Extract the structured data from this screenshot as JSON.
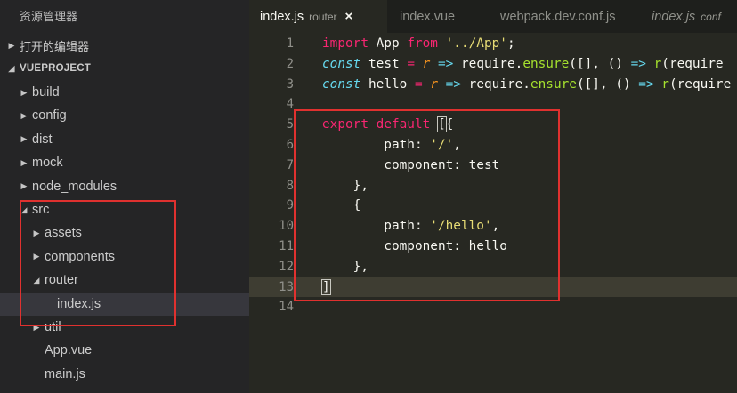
{
  "explorer": {
    "title": "资源管理器",
    "open_editors": "打开的编辑器",
    "project": "VUEPROJECT"
  },
  "tree": [
    {
      "label": "build",
      "kind": "folder",
      "expanded": false,
      "depth": 0
    },
    {
      "label": "config",
      "kind": "folder",
      "expanded": false,
      "depth": 0
    },
    {
      "label": "dist",
      "kind": "folder",
      "expanded": false,
      "depth": 0
    },
    {
      "label": "mock",
      "kind": "folder",
      "expanded": false,
      "depth": 0
    },
    {
      "label": "node_modules",
      "kind": "folder",
      "expanded": false,
      "depth": 0
    },
    {
      "label": "src",
      "kind": "folder",
      "expanded": true,
      "depth": 0
    },
    {
      "label": "assets",
      "kind": "folder",
      "expanded": false,
      "depth": 1
    },
    {
      "label": "components",
      "kind": "folder",
      "expanded": false,
      "depth": 1
    },
    {
      "label": "router",
      "kind": "folder",
      "expanded": true,
      "depth": 1
    },
    {
      "label": "index.js",
      "kind": "file",
      "depth": 2,
      "selected": true
    },
    {
      "label": "util",
      "kind": "folder",
      "expanded": false,
      "depth": 1
    },
    {
      "label": "App.vue",
      "kind": "file",
      "depth": 1
    },
    {
      "label": "main.js",
      "kind": "file",
      "depth": 1
    }
  ],
  "tabs": [
    {
      "label": "index.js",
      "description": "router",
      "active": true,
      "close": "×"
    },
    {
      "label": "index.vue",
      "description": "",
      "active": false
    },
    {
      "label": "webpack.dev.conf.js",
      "description": "",
      "active": false
    },
    {
      "label": "index.js",
      "description": "conf",
      "active": false,
      "italic": true
    }
  ],
  "code_lines": [
    {
      "n": "1",
      "tokens": [
        [
          "kw",
          "import"
        ],
        [
          "pl",
          " App "
        ],
        [
          "kw",
          "from"
        ],
        [
          "pl",
          " "
        ],
        [
          "str",
          "'../App'"
        ],
        [
          "pl",
          ";"
        ]
      ]
    },
    {
      "n": "2",
      "tokens": [
        [
          "st",
          "const"
        ],
        [
          "pl",
          " test "
        ],
        [
          "kw",
          "="
        ],
        [
          "pl",
          " "
        ],
        [
          "par",
          "r"
        ],
        [
          "pl",
          " "
        ],
        [
          "st",
          "=>"
        ],
        [
          "pl",
          " require."
        ],
        [
          "fn",
          "ensure"
        ],
        [
          "pl",
          "([], () "
        ],
        [
          "st",
          "=>"
        ],
        [
          "pl",
          " "
        ],
        [
          "fn",
          "r"
        ],
        [
          "pl",
          "(require"
        ]
      ]
    },
    {
      "n": "3",
      "tokens": [
        [
          "st",
          "const"
        ],
        [
          "pl",
          " hello "
        ],
        [
          "kw",
          "="
        ],
        [
          "pl",
          " "
        ],
        [
          "par",
          "r"
        ],
        [
          "pl",
          " "
        ],
        [
          "st",
          "=>"
        ],
        [
          "pl",
          " require."
        ],
        [
          "fn",
          "ensure"
        ],
        [
          "pl",
          "([], () "
        ],
        [
          "st",
          "=>"
        ],
        [
          "pl",
          " "
        ],
        [
          "fn",
          "r"
        ],
        [
          "pl",
          "(require"
        ]
      ]
    },
    {
      "n": "4",
      "tokens": []
    },
    {
      "n": "5",
      "tokens": [
        [
          "kw",
          "export"
        ],
        [
          "pl",
          " "
        ],
        [
          "kw",
          "default"
        ],
        [
          "pl",
          " "
        ],
        [
          "bracket",
          "["
        ],
        [
          "pl",
          "{"
        ]
      ]
    },
    {
      "n": "6",
      "tokens": [
        [
          "pl",
          "        path: "
        ],
        [
          "str",
          "'/'"
        ],
        [
          "pl",
          ","
        ]
      ]
    },
    {
      "n": "7",
      "tokens": [
        [
          "pl",
          "        component: test"
        ]
      ]
    },
    {
      "n": "8",
      "tokens": [
        [
          "pl",
          "    },"
        ]
      ]
    },
    {
      "n": "9",
      "tokens": [
        [
          "pl",
          "    {"
        ]
      ]
    },
    {
      "n": "10",
      "tokens": [
        [
          "pl",
          "        path: "
        ],
        [
          "str",
          "'/hello'"
        ],
        [
          "pl",
          ","
        ]
      ]
    },
    {
      "n": "11",
      "tokens": [
        [
          "pl",
          "        component: hello"
        ]
      ]
    },
    {
      "n": "12",
      "tokens": [
        [
          "pl",
          "    },"
        ]
      ]
    },
    {
      "n": "13",
      "tokens": [
        [
          "bracket",
          "]"
        ]
      ],
      "current": true
    },
    {
      "n": "14",
      "tokens": []
    }
  ]
}
